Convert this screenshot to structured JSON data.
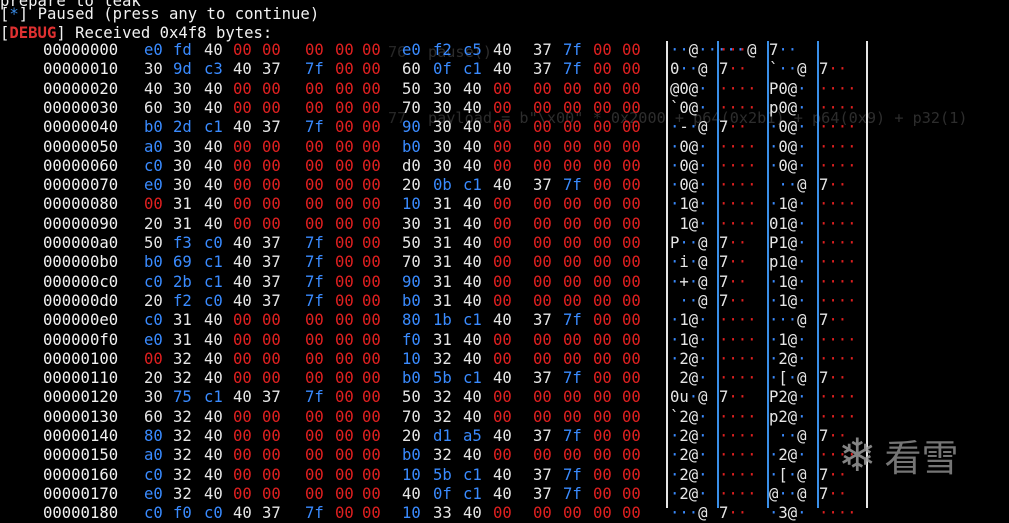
{
  "terminal": {
    "top_cut": "prepare to leak",
    "paused_marker": "*",
    "paused_text": "Paused (press any to continue)",
    "debug_tag": "DEBUG",
    "received_text": "Received 0x4f8 bytes:"
  },
  "hexdump": [
    {
      "offset": "00000000",
      "bytes": [
        "e0",
        "fd",
        "40",
        "00",
        "00",
        "00",
        "00",
        "00",
        "e0",
        "f2",
        "c5",
        "40",
        "37",
        "7f",
        "00",
        "00"
      ],
      "ascii": "··@·····│···@│7··"
    },
    {
      "offset": "00000010",
      "bytes": [
        "30",
        "9d",
        "c3",
        "40",
        "37",
        "7f",
        "00",
        "00",
        "60",
        "0f",
        "c1",
        "40",
        "37",
        "7f",
        "00",
        "00"
      ],
      "ascii": "0··@│7··│`··@│7··"
    },
    {
      "offset": "00000020",
      "bytes": [
        "40",
        "30",
        "40",
        "00",
        "00",
        "00",
        "00",
        "00",
        "50",
        "30",
        "40",
        "00",
        "00",
        "00",
        "00",
        "00"
      ],
      "ascii": "@0@·│····│P0@·│····"
    },
    {
      "offset": "00000030",
      "bytes": [
        "60",
        "30",
        "40",
        "00",
        "00",
        "00",
        "00",
        "00",
        "70",
        "30",
        "40",
        "00",
        "00",
        "00",
        "00",
        "00"
      ],
      "ascii": "`0@·│····│p0@·│····"
    },
    {
      "offset": "00000040",
      "bytes": [
        "b0",
        "2d",
        "c1",
        "40",
        "37",
        "7f",
        "00",
        "00",
        "90",
        "30",
        "40",
        "00",
        "00",
        "00",
        "00",
        "00"
      ],
      "ascii": "·-·@│7··│·0@·│····"
    },
    {
      "offset": "00000050",
      "bytes": [
        "a0",
        "30",
        "40",
        "00",
        "00",
        "00",
        "00",
        "00",
        "b0",
        "30",
        "40",
        "00",
        "00",
        "00",
        "00",
        "00"
      ],
      "ascii": "·0@·│····│·0@·│····"
    },
    {
      "offset": "00000060",
      "bytes": [
        "c0",
        "30",
        "40",
        "00",
        "00",
        "00",
        "00",
        "00",
        "d0",
        "30",
        "40",
        "00",
        "00",
        "00",
        "00",
        "00"
      ],
      "ascii": "·0@·│····│·0@·│····"
    },
    {
      "offset": "00000070",
      "bytes": [
        "e0",
        "30",
        "40",
        "00",
        "00",
        "00",
        "00",
        "00",
        "20",
        "0b",
        "c1",
        "40",
        "37",
        "7f",
        "00",
        "00"
      ],
      "ascii": "·0@·│····│ ··@│7··"
    },
    {
      "offset": "00000080",
      "bytes": [
        "00",
        "31",
        "40",
        "00",
        "00",
        "00",
        "00",
        "00",
        "10",
        "31",
        "40",
        "00",
        "00",
        "00",
        "00",
        "00"
      ],
      "ascii": "·1@·│····│·1@·│····"
    },
    {
      "offset": "00000090",
      "bytes": [
        "20",
        "31",
        "40",
        "00",
        "00",
        "00",
        "00",
        "00",
        "30",
        "31",
        "40",
        "00",
        "00",
        "00",
        "00",
        "00"
      ],
      "ascii": " 1@·│····│01@·│····"
    },
    {
      "offset": "000000a0",
      "bytes": [
        "50",
        "f3",
        "c0",
        "40",
        "37",
        "7f",
        "00",
        "00",
        "50",
        "31",
        "40",
        "00",
        "00",
        "00",
        "00",
        "00"
      ],
      "ascii": "P··@│7··│P1@·│····"
    },
    {
      "offset": "000000b0",
      "bytes": [
        "b0",
        "69",
        "c1",
        "40",
        "37",
        "7f",
        "00",
        "00",
        "70",
        "31",
        "40",
        "00",
        "00",
        "00",
        "00",
        "00"
      ],
      "ascii": "·i·@│7··│p1@·│····"
    },
    {
      "offset": "000000c0",
      "bytes": [
        "c0",
        "2b",
        "c1",
        "40",
        "37",
        "7f",
        "00",
        "00",
        "90",
        "31",
        "40",
        "00",
        "00",
        "00",
        "00",
        "00"
      ],
      "ascii": "·+·@│7··│·1@·│····"
    },
    {
      "offset": "000000d0",
      "bytes": [
        "20",
        "f2",
        "c0",
        "40",
        "37",
        "7f",
        "00",
        "00",
        "b0",
        "31",
        "40",
        "00",
        "00",
        "00",
        "00",
        "00"
      ],
      "ascii": " ··@│7··│·1@·│····"
    },
    {
      "offset": "000000e0",
      "bytes": [
        "c0",
        "31",
        "40",
        "00",
        "00",
        "00",
        "00",
        "00",
        "80",
        "1b",
        "c1",
        "40",
        "37",
        "7f",
        "00",
        "00"
      ],
      "ascii": "·1@·│····│···@│7··"
    },
    {
      "offset": "000000f0",
      "bytes": [
        "e0",
        "31",
        "40",
        "00",
        "00",
        "00",
        "00",
        "00",
        "f0",
        "31",
        "40",
        "00",
        "00",
        "00",
        "00",
        "00"
      ],
      "ascii": "·1@·│····│·1@·│····"
    },
    {
      "offset": "00000100",
      "bytes": [
        "00",
        "32",
        "40",
        "00",
        "00",
        "00",
        "00",
        "00",
        "10",
        "32",
        "40",
        "00",
        "00",
        "00",
        "00",
        "00"
      ],
      "ascii": "·2@·│····│·2@·│····"
    },
    {
      "offset": "00000110",
      "bytes": [
        "20",
        "32",
        "40",
        "00",
        "00",
        "00",
        "00",
        "00",
        "b0",
        "5b",
        "c1",
        "40",
        "37",
        "7f",
        "00",
        "00"
      ],
      "ascii": " 2@·│····│·[·@│7··"
    },
    {
      "offset": "00000120",
      "bytes": [
        "30",
        "75",
        "c1",
        "40",
        "37",
        "7f",
        "00",
        "00",
        "50",
        "32",
        "40",
        "00",
        "00",
        "00",
        "00",
        "00"
      ],
      "ascii": "0u·@│7··│P2@·│····"
    },
    {
      "offset": "00000130",
      "bytes": [
        "60",
        "32",
        "40",
        "00",
        "00",
        "00",
        "00",
        "00",
        "70",
        "32",
        "40",
        "00",
        "00",
        "00",
        "00",
        "00"
      ],
      "ascii": "`2@·│····│p2@·│····"
    },
    {
      "offset": "00000140",
      "bytes": [
        "80",
        "32",
        "40",
        "00",
        "00",
        "00",
        "00",
        "00",
        "20",
        "d1",
        "a5",
        "40",
        "37",
        "7f",
        "00",
        "00"
      ],
      "ascii": "·2@·│····│ ··@│7··"
    },
    {
      "offset": "00000150",
      "bytes": [
        "a0",
        "32",
        "40",
        "00",
        "00",
        "00",
        "00",
        "00",
        "b0",
        "32",
        "40",
        "00",
        "00",
        "00",
        "00",
        "00"
      ],
      "ascii": "·2@·│····│·2@·│····"
    },
    {
      "offset": "00000160",
      "bytes": [
        "c0",
        "32",
        "40",
        "00",
        "00",
        "00",
        "00",
        "00",
        "10",
        "5b",
        "c1",
        "40",
        "37",
        "7f",
        "00",
        "00"
      ],
      "ascii": "·2@·│····│·[·@│7··"
    },
    {
      "offset": "00000170",
      "bytes": [
        "e0",
        "32",
        "40",
        "00",
        "00",
        "00",
        "00",
        "00",
        "40",
        "0f",
        "c1",
        "40",
        "37",
        "7f",
        "00",
        "00"
      ],
      "ascii": "·2@·│····│@··@│7··"
    },
    {
      "offset": "00000180",
      "bytes": [
        "c0",
        "f0",
        "c0",
        "40",
        "37",
        "7f",
        "00",
        "00",
        "10",
        "33",
        "40",
        "00",
        "00",
        "00",
        "00",
        "00"
      ],
      "ascii": "···@│7··│·3@·│····"
    }
  ],
  "background_editor": {
    "line_numbers": [
      "76",
      "77"
    ],
    "code_lines": [
      "pause()",
      "payload = b\"\\x00\" * 0x2000 + p64(0x2b1) + p64(0x9) + p32(1)"
    ]
  },
  "watermark": {
    "icon": "snowflake-icon",
    "text": "看雪"
  },
  "colors": {
    "background": "#000000",
    "nonzero_byte": "#e6e6e6",
    "special_byte": "#3a8bff",
    "zero_byte": "#e02020",
    "separator": "#3a8fe8"
  }
}
